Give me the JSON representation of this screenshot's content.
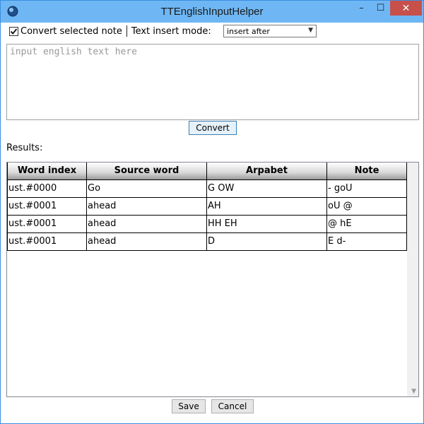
{
  "window": {
    "title": "TTEnglishInputHelper",
    "minimize": "–",
    "maximize": "☐",
    "close": "✕"
  },
  "options": {
    "checkbox_checked": true,
    "checkbox_label": "Convert selected note",
    "insert_mode_label": "Text insert mode:",
    "insert_mode_value": "insert after"
  },
  "input": {
    "placeholder": "input english text here"
  },
  "buttons": {
    "convert": "Convert",
    "save": "Save",
    "cancel": "Cancel"
  },
  "results": {
    "label": "Results:",
    "columns": [
      "Word index",
      "Source word",
      "Arpabet",
      "Note"
    ],
    "rows": [
      [
        "ust.#0000",
        "Go",
        "G OW",
        "- goU"
      ],
      [
        "ust.#0001",
        "ahead",
        "AH",
        "oU @"
      ],
      [
        "ust.#0001",
        "ahead",
        "HH EH",
        "@ hE"
      ],
      [
        "ust.#0001",
        "ahead",
        "D",
        "E d-"
      ]
    ]
  },
  "colors": {
    "titlebar": "#6fb7f4",
    "close_button": "#c7504b",
    "window_border": "#3c8ddf"
  }
}
